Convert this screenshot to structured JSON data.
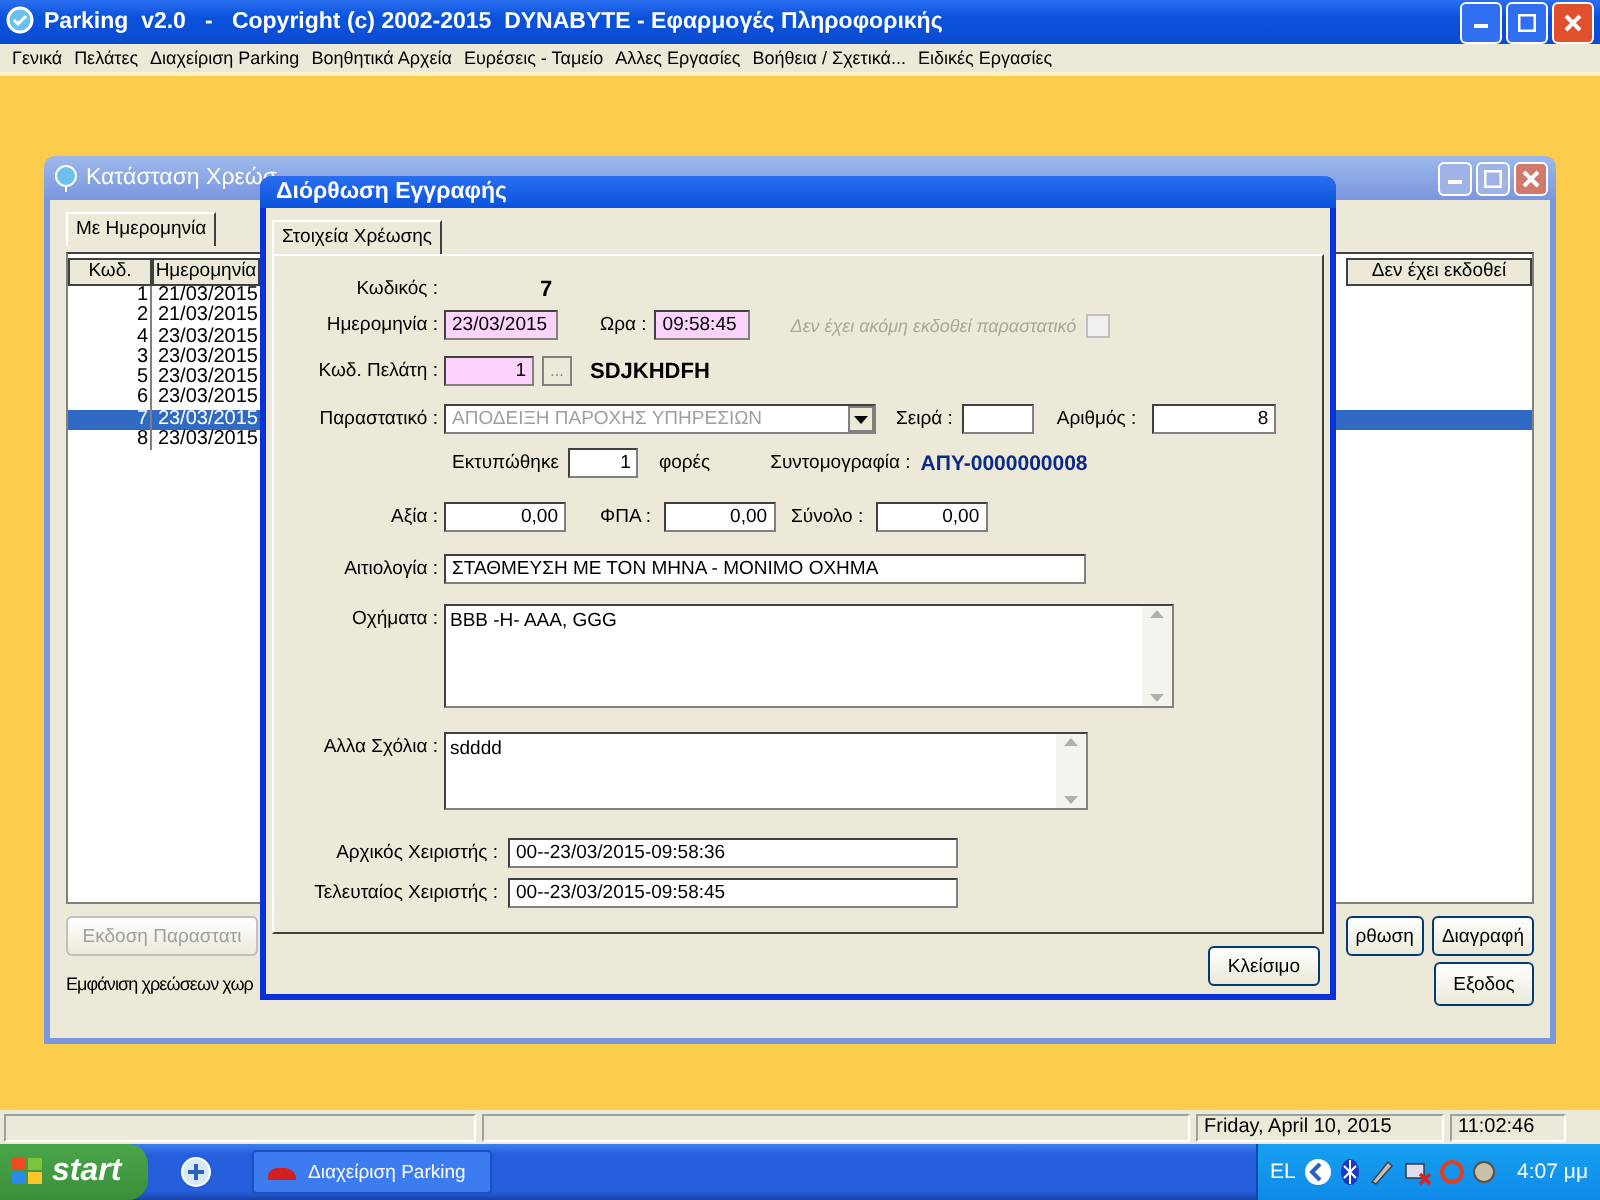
{
  "app": {
    "title": "Parking  v2.0   -   Copyright (c) 2002-2015  DYNABYTE - Εφαρμογές Πληροφορικής",
    "menu": [
      "Γενικά",
      "Πελάτες",
      "Διαχείριση Parking",
      "Βοηθητικά Αρχεία",
      "Ευρέσεις - Ταμείο",
      "Αλλες Εργασίες",
      "Βοήθεια / Σχετικά...",
      "Ειδικές Εργασίες"
    ]
  },
  "charges_window": {
    "title": "Κατάσταση Χρεώσ",
    "tab": "Με Ημερομηνία",
    "columns": [
      "Κωδ.",
      "Ημερομηνία",
      "Δεν έχει εκδοθεί"
    ],
    "rows": [
      {
        "code": "1",
        "date": "21/03/2015",
        "selected": false
      },
      {
        "code": "2",
        "date": "21/03/2015",
        "selected": false
      },
      {
        "code": "4",
        "date": "23/03/2015",
        "selected": false
      },
      {
        "code": "3",
        "date": "23/03/2015",
        "selected": false
      },
      {
        "code": "5",
        "date": "23/03/2015",
        "selected": false
      },
      {
        "code": "6",
        "date": "23/03/2015",
        "selected": false
      },
      {
        "code": "7",
        "date": "23/03/2015",
        "selected": true
      },
      {
        "code": "8",
        "date": "23/03/2015",
        "selected": false
      }
    ],
    "issue_button": {
      "label": "Εκδοση Παραστατι",
      "disabled": true
    },
    "edit_button": "ρθωση",
    "delete_button": "Διαγραφή",
    "status_text": "Εμφάνιση χρεώσεων χωρ",
    "exit_button": "Εξοδος"
  },
  "dialog": {
    "title": "Διόρθωση Εγγραφής",
    "tab": "Στοιχεία Χρέωσης",
    "code": {
      "label": "Κωδικός :",
      "value": "7"
    },
    "date": {
      "label": "Ημερομηνία :",
      "value": "23/03/2015",
      "required": true
    },
    "time": {
      "label": "Ωρα :",
      "value": "09:58:45",
      "required": true
    },
    "not_issued": {
      "label": "Δεν έχει ακόμη εκδοθεί παραστατικό",
      "checked": false,
      "disabled": true
    },
    "customer": {
      "label": "Κωδ. Πελάτη :",
      "value": "1",
      "required": true,
      "browse": "...",
      "name": "SDJKHDFH"
    },
    "document": {
      "label": "Παραστατικό :",
      "value": "ΑΠΟΔΕΙΞΗ ΠΑΡΟΧΗΣ ΥΠΗΡΕΣΙΩΝ",
      "disabled": true
    },
    "series": {
      "label": "Σειρά :"
    },
    "number": {
      "label": "Αριθμός :",
      "value": "8"
    },
    "printed": {
      "label": "Εκτυπώθηκε",
      "value": "1",
      "suffix": "φορές"
    },
    "abbreviation": {
      "label": "Συντομογραφία :",
      "value": "ΑΠΥ-0000000008"
    },
    "amounts": [
      {
        "label": "Αξία :",
        "value": "0,00"
      },
      {
        "label": "ΦΠΑ :",
        "value": "0,00"
      },
      {
        "label": "Σύνολο :",
        "value": "0,00"
      }
    ],
    "reason": {
      "label": "Αιτιολογία :",
      "value": "ΣΤΑΘΜΕΥΣΗ ΜΕ ΤΟΝ ΜΗΝΑ - ΜΟΝΙΜΟ ΟΧΗΜΑ"
    },
    "vehicles": {
      "label": "Οχήματα :",
      "value": "BBB -H- AAA, GGG"
    },
    "comments": {
      "label": "Αλλα Σχόλια :",
      "value": "sdddd"
    },
    "operators": [
      {
        "label": "Αρχικός Χειριστής :",
        "value": "00--23/03/2015-09:58:36"
      },
      {
        "label": "Τελευταίος Χειριστής :",
        "value": "00--23/03/2015-09:58:45"
      }
    ],
    "close_button": "Κλείσιμο"
  },
  "status_bar": {
    "date": "Friday, April 10, 2015",
    "time": "11:02:46"
  },
  "taskbar": {
    "start": "start",
    "task": "Διαχείριση Parking",
    "language": "EL",
    "clock": "4:07 μμ"
  }
}
